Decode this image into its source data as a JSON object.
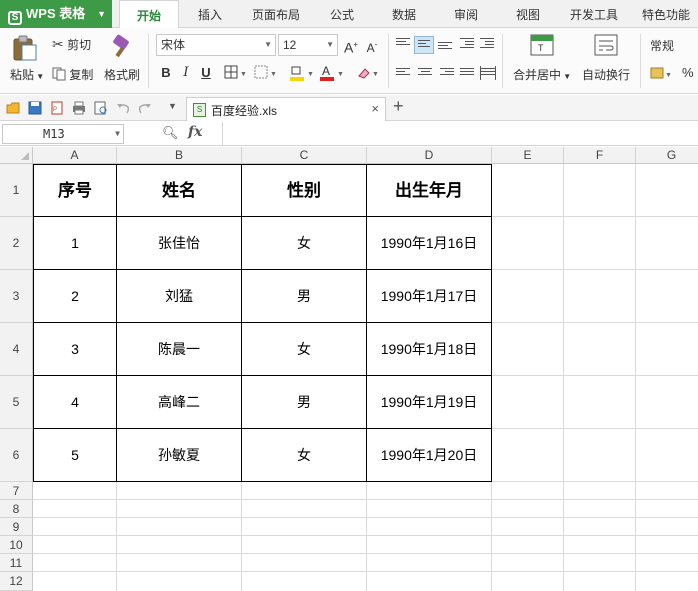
{
  "app": {
    "logo": "WPS 表格"
  },
  "menu": {
    "tabs": [
      "开始",
      "插入",
      "页面布局",
      "公式",
      "数据",
      "审阅",
      "视图",
      "开发工具",
      "特色功能"
    ],
    "active": "开始"
  },
  "ribbon": {
    "paste": "粘贴",
    "cut": "剪切",
    "copy": "复制",
    "format_painter": "格式刷",
    "font_name": "宋体",
    "font_size": "12",
    "merge_center": "合并居中",
    "wrap_text": "自动换行",
    "number_format": "常规",
    "percent": "%"
  },
  "file_tab": {
    "name": "百度经验.xls"
  },
  "formula_bar": {
    "cell_ref": "M13",
    "fx": "fx",
    "value": ""
  },
  "sheet": {
    "columns": [
      "A",
      "B",
      "C",
      "D",
      "E",
      "F",
      "G"
    ],
    "rows": [
      "1",
      "2",
      "3",
      "4",
      "5",
      "6",
      "7",
      "8",
      "9",
      "10",
      "11",
      "12"
    ],
    "table": {
      "headers": [
        "序号",
        "姓名",
        "性别",
        "出生年月"
      ],
      "rows": [
        [
          "1",
          "张佳怡",
          "女",
          "1990年1月16日"
        ],
        [
          "2",
          "刘猛",
          "男",
          "1990年1月17日"
        ],
        [
          "3",
          "陈晨一",
          "女",
          "1990年1月18日"
        ],
        [
          "4",
          "高峰二",
          "男",
          "1990年1月19日"
        ],
        [
          "5",
          "孙敏夏",
          "女",
          "1990年1月20日"
        ]
      ]
    }
  },
  "colors": {
    "accent": "#3d9a47",
    "active_tab_text": "#2a8a3c"
  }
}
